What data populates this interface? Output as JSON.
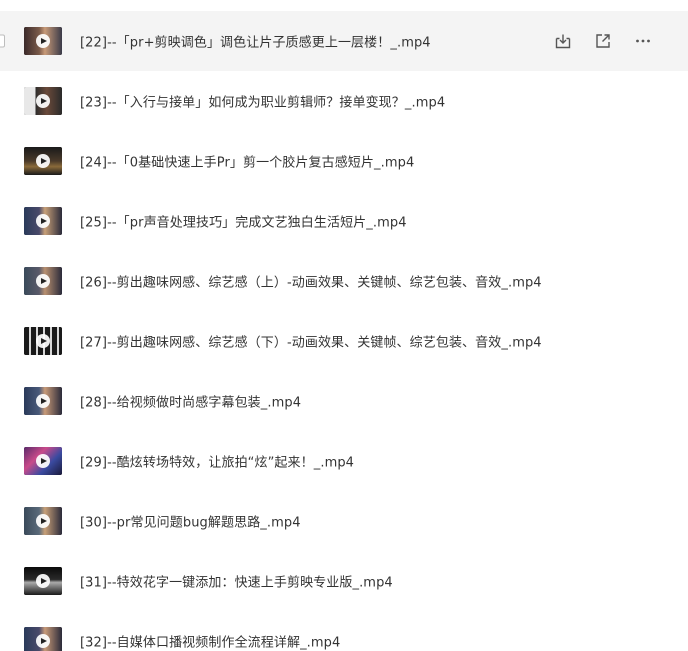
{
  "files": [
    {
      "name": "[22]--「pr+剪映调色」调色让片子质感更上一层楼！_.mp4",
      "active": true
    },
    {
      "name": "[23]--「入行与接单」如何成为职业剪辑师？接单变现？_.mp4",
      "active": false
    },
    {
      "name": "[24]--「0基础快速上手Pr」剪一个胶片复古感短片_.mp4",
      "active": false
    },
    {
      "name": "[25]--「pr声音处理技巧」完成文艺独白生活短片_.mp4",
      "active": false
    },
    {
      "name": "[26]--剪出趣味网感、综艺感（上）-动画效果、关键帧、综艺包装、音效_.mp4",
      "active": false
    },
    {
      "name": "[27]--剪出趣味网感、综艺感（下）-动画效果、关键帧、综艺包装、音效_.mp4",
      "active": false
    },
    {
      "name": "[28]--给视频做时尚感字幕包装_.mp4",
      "active": false
    },
    {
      "name": "[29]--酷炫转场特效，让旅拍“炫”起来！_.mp4",
      "active": false
    },
    {
      "name": "[30]--pr常见问题bug解题思路_.mp4",
      "active": false
    },
    {
      "name": "[31]--特效花字一键添加：快速上手剪映专业版_.mp4",
      "active": false
    },
    {
      "name": "[32]--自媒体口播视频制作全流程详解_.mp4",
      "active": false
    }
  ],
  "row_actions": {
    "download_icon": "download-icon",
    "share_icon": "share-icon",
    "more_icon": "more-icon"
  },
  "colors": {
    "active_row_bg": "#f4f4f4",
    "text": "#333333",
    "icon": "#555555"
  }
}
